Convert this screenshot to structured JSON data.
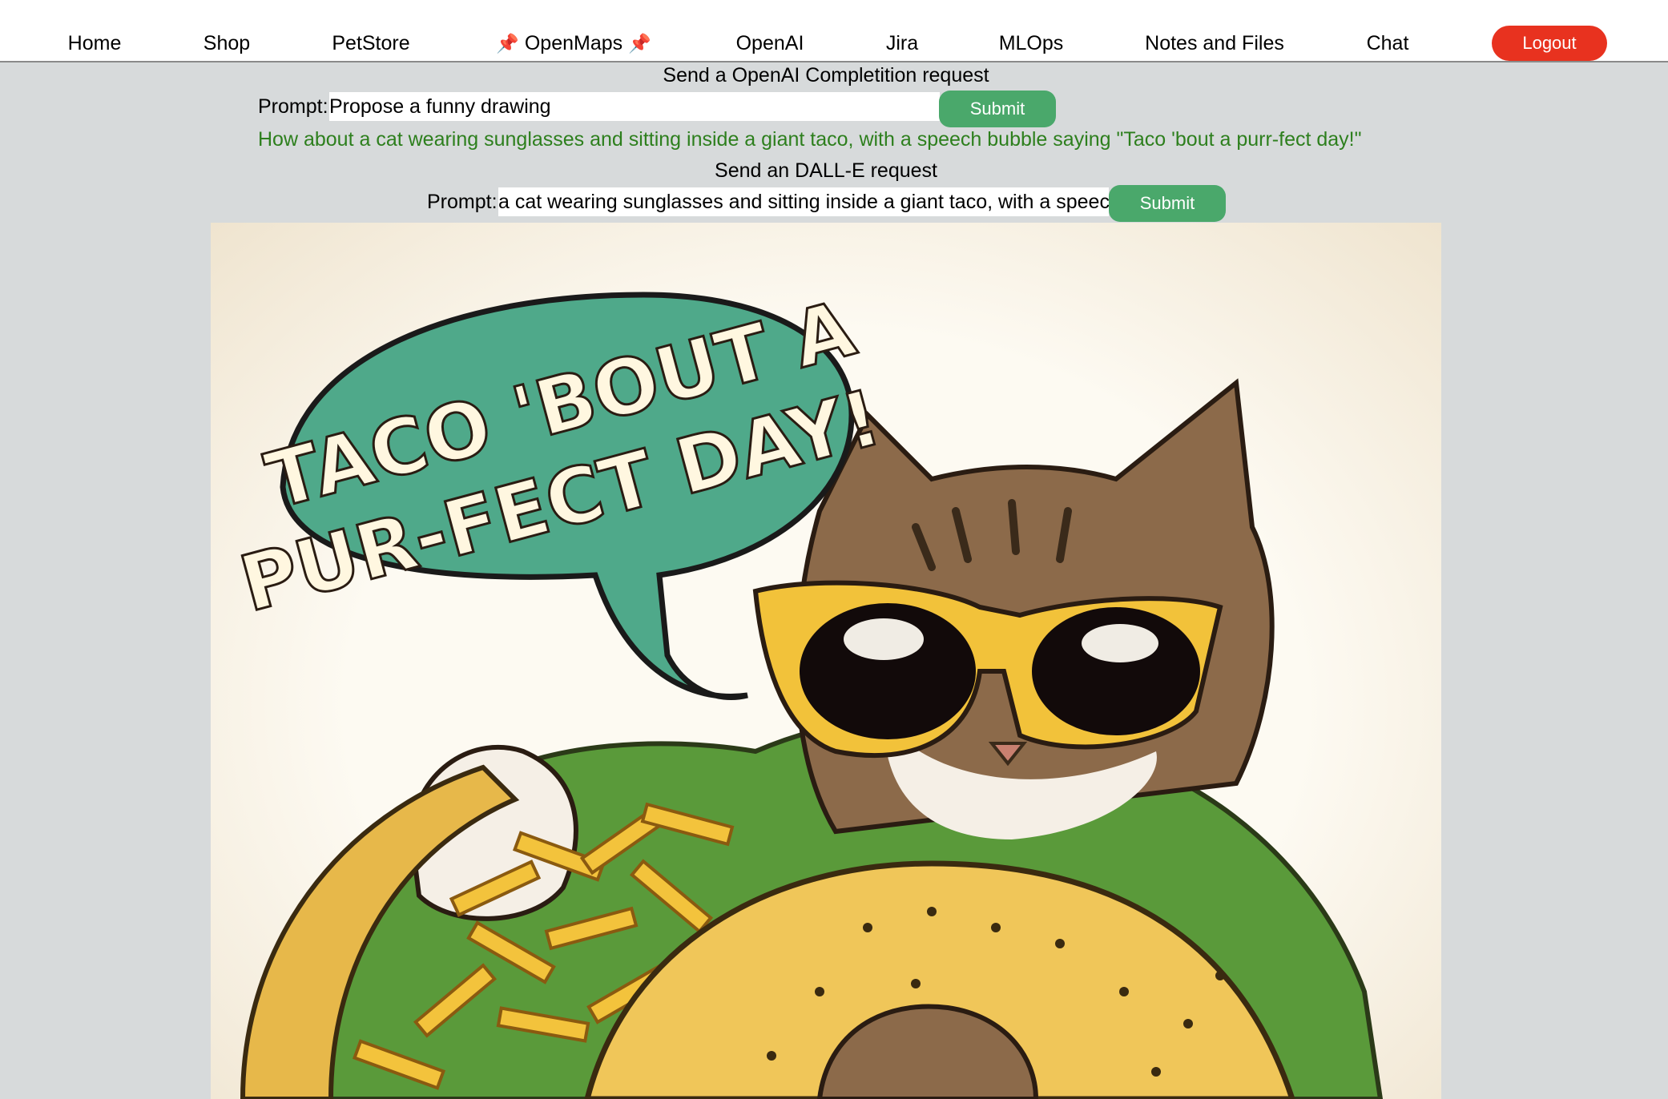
{
  "nav": {
    "items": [
      "Home",
      "Shop",
      "PetStore",
      "OpenMaps",
      "OpenAI",
      "Jira",
      "MLOps",
      "Notes and Files",
      "Chat"
    ],
    "pin_glyph": "📌",
    "logout_label": "Logout"
  },
  "completion_section": {
    "heading": "Send a OpenAI Completition request",
    "prompt_label": "Prompt:",
    "prompt_value": "Propose a funny drawing",
    "submit_label": "Submit",
    "response": "How about a cat wearing sunglasses and sitting inside a giant taco, with a speech bubble saying \"Taco 'bout a purr-fect day!\""
  },
  "dalle_section": {
    "heading": "Send an DALL-E request",
    "prompt_label": "Prompt:",
    "prompt_value": "a cat wearing sunglasses and sitting inside a giant taco, with a speech bubble saying \"Taco 'bout a purr-fect day!\"",
    "submit_label": "Submit"
  },
  "generated_image": {
    "speech_line1": "TACO 'BOUT A",
    "speech_line2": "PUR-FECT DAY!"
  },
  "colors": {
    "logout": "#e8321f",
    "submit": "#4aa86b",
    "response_text": "#2d7f1d",
    "page_bg": "#d7dadb",
    "speech_bubble": "#4fa98a",
    "taco_shell": "#f0c659",
    "lettuce": "#5a9a3a",
    "cheese": "#f3c33c",
    "sunglasses_frame": "#f2c23a"
  }
}
